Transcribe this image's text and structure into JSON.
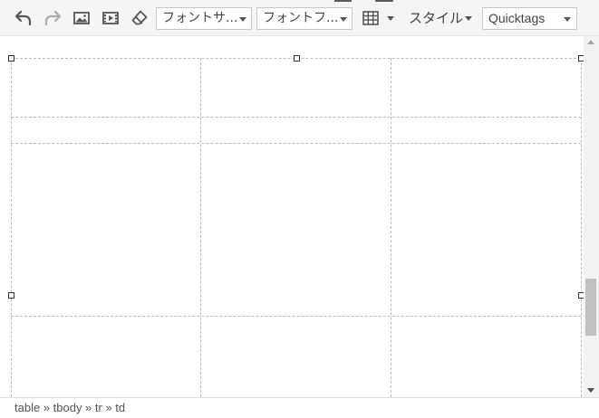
{
  "toolbar": {
    "buttons": [
      {
        "icon": "undo-icon"
      },
      {
        "icon": "redo-icon"
      },
      {
        "icon": "image-icon"
      },
      {
        "icon": "media-icon"
      },
      {
        "icon": "eraser-icon"
      },
      {
        "icon": "table-icon"
      }
    ],
    "font_size": {
      "value": "フォントサ..."
    },
    "font_family": {
      "value": "フォントフ..."
    },
    "style": {
      "label": "スタイル"
    },
    "quicktags": {
      "value": "Quicktags"
    }
  },
  "statusbar": {
    "path": "table » tbody » tr » td"
  },
  "colors": {
    "toolbar_bg": "#f5f5f5",
    "border": "#c8c8c8",
    "dashed_grid": "#bbbbbb",
    "icon_active": "#555555",
    "icon_disabled": "#aaaaaa",
    "scroll_thumb": "#c1c1c1"
  }
}
